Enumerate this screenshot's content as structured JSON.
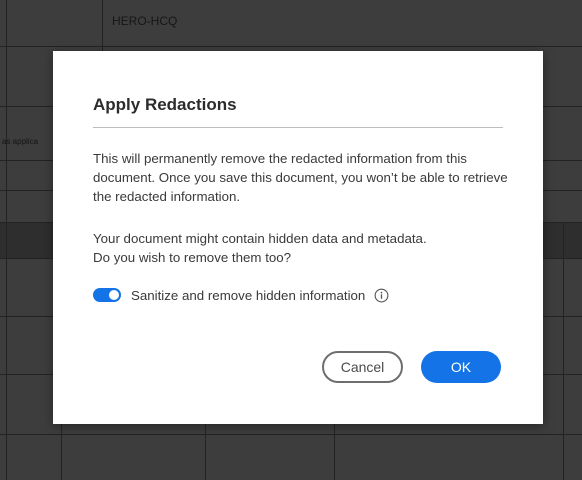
{
  "background": {
    "header_cell_text": "HERO-HCQ",
    "left_clip_text": "as applica"
  },
  "dialog": {
    "title": "Apply Redactions",
    "paragraph_1": "This will permanently remove the redacted information from this document. Once you save this document, you won’t be able to retrieve the redacted information.",
    "paragraph_2_line_1": "Your document might contain hidden data and metadata.",
    "paragraph_2_line_2": "Do you wish to remove them too?",
    "sanitize_toggle": {
      "label": "Sanitize and remove hidden information",
      "checked": true,
      "info_icon": "info-icon"
    },
    "buttons": {
      "cancel_label": "Cancel",
      "ok_label": "OK"
    }
  },
  "colors": {
    "accent": "#1473e6",
    "dialog_bg": "#ffffff",
    "backdrop": "#3b3b3b"
  }
}
